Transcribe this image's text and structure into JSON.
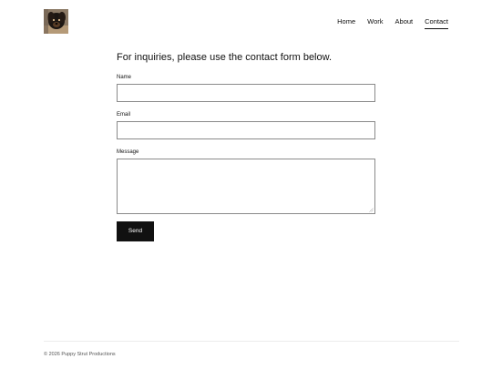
{
  "header": {
    "logo_icon": "puppy-photo-icon",
    "nav": [
      {
        "label": "Home",
        "active": false
      },
      {
        "label": "Work",
        "active": false
      },
      {
        "label": "About",
        "active": false
      },
      {
        "label": "Contact",
        "active": true
      }
    ]
  },
  "main": {
    "heading": "For inquiries, please use the contact form below.",
    "form": {
      "name_label": "Name",
      "name_value": "",
      "email_label": "Email",
      "email_value": "",
      "message_label": "Message",
      "message_value": "",
      "send_label": "Send"
    }
  },
  "footer": {
    "copyright": "© 2026 Puppy Strut Productions"
  },
  "colors": {
    "text": "#111111",
    "button_bg": "#111111",
    "button_text": "#ffffff",
    "input_border": "#8a8a8a",
    "footer_text": "#555555"
  }
}
